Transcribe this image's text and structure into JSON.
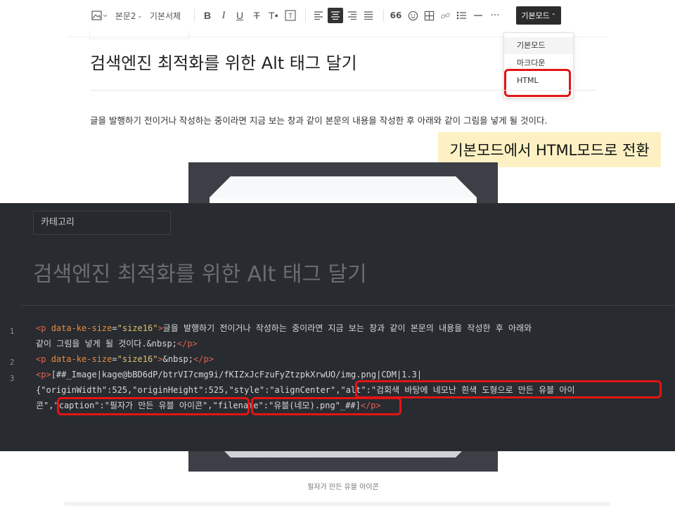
{
  "toolbar": {
    "style_label": "본문2",
    "font_label": "기본서체",
    "quote_label": "66",
    "mode_label": "기본모드"
  },
  "dropdown": {
    "items": [
      {
        "label": "기본모드"
      },
      {
        "label": "마크다운"
      },
      {
        "label": "HTML"
      }
    ]
  },
  "post": {
    "title": "검색엔진 최적화를 위한 Alt 태그 달기",
    "paragraph": "글을 발행하기 전이거나 작성하는 중이라면 지금 보는 창과 같이 본문의 내용을 작성한 후 아래와 같이 그림을 넣게 될 것이다.",
    "caption": "필자가 만든 유블 아이콘"
  },
  "annotation": {
    "text": "기본모드에서 HTML모드로 전환"
  },
  "html_mode": {
    "category_label": "카테고리",
    "title": "검색엔진 최적화를 위한 Alt 태그 달기",
    "line_numbers": [
      "1",
      "2",
      "3"
    ],
    "code": {
      "l1_open": "<p ",
      "l1_attr": "data-ke-size",
      "l1_eq": "=",
      "l1_val": "\"size16\"",
      "l1_close": ">",
      "l1_text_a": "글을 발행하기 전이거나 작성하는 중이라면 지금 보는 창과 같이 본문의 내용을 작성한 후 아래와",
      "l1_text_b": "같이 그림을 넣게 될 것이다.&nbsp;",
      "l1_end": "</p>",
      "l2_open": "<p ",
      "l2_attr": "data-ke-size",
      "l2_eq": "=",
      "l2_val": "\"size16\"",
      "l2_close": ">",
      "l2_text": "&nbsp;",
      "l2_end": "</p>",
      "l3_open": "<p>",
      "l3_text_a": "[##_Image|kage@bBD6dP/btrVI7cmg9i/fKIZxJcFzuFyZtzpkXrwUO/img.png|CDM|1.3|",
      "l3_text_b": "{\"originWidth\":525,\"originHeight\":525,\"style\":\"alignCenter\",",
      "l3_alt": "\"alt\":\"검회색 바탕에 네모난 흰색 도형으로 만든 유블 아이",
      "l3_alt_tail": "콘\",",
      "l3_caption": "\"caption\":\"필자가 만든 유블 아이콘\"",
      "l3_comma": ",",
      "l3_filename": "\"filename\":\"유블(네모).png\"",
      "l3_end_text": "_##]",
      "l3_end": "</p>"
    }
  },
  "colors": {
    "highlight_red": "#e31515",
    "note_bg": "#fdf1c4",
    "code_bg": "#282b30",
    "tag": "#e0624f",
    "attr": "#e98a3d",
    "value": "#e0c36d"
  }
}
